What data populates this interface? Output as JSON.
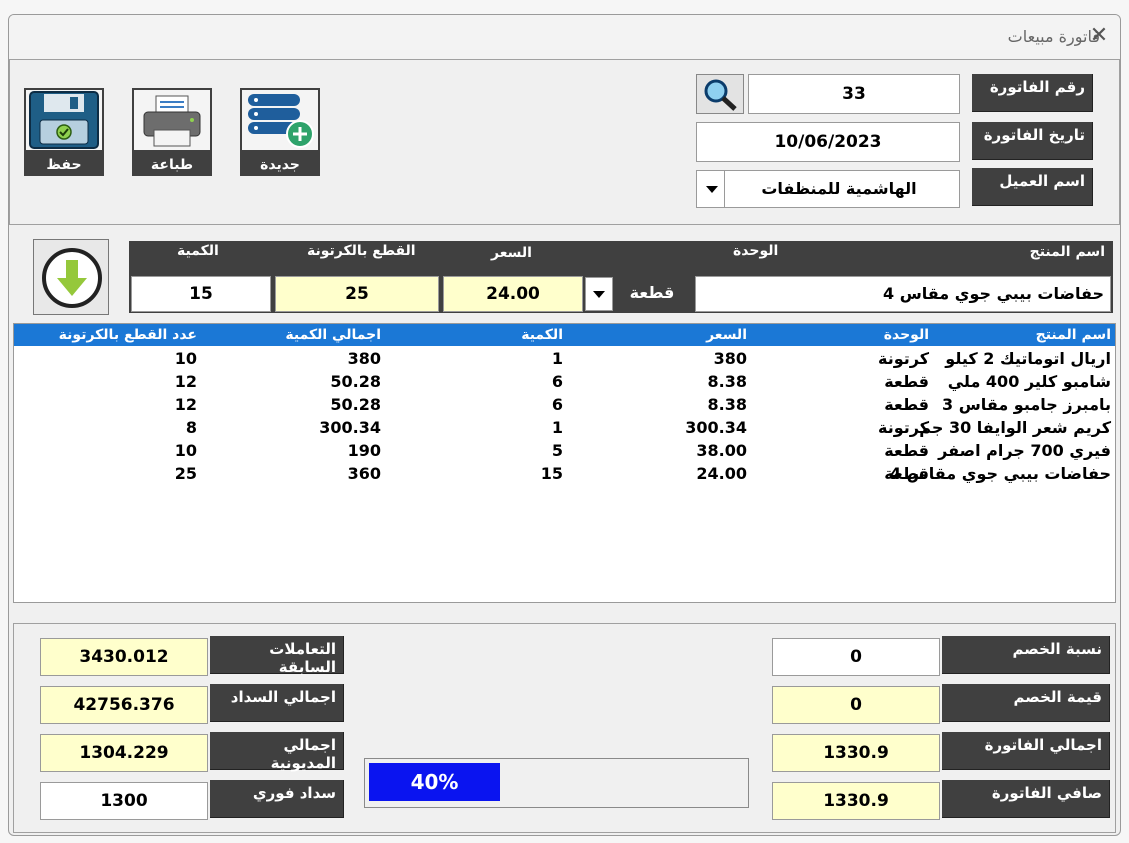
{
  "window": {
    "title": "فاتورة مبيعات",
    "close_glyph": "✕"
  },
  "toolbar": {
    "save_label": "حفظ",
    "print_label": "طباعة",
    "new_label": "جديدة"
  },
  "header": {
    "invoice_no_label": "رقم الفاتورة",
    "invoice_no": "33",
    "invoice_date_label": "تاريخ الفاتورة",
    "invoice_date": "10/06/2023",
    "customer_label": "اسم العميل",
    "customer": "الهاشمية للمنظفات"
  },
  "entry": {
    "labels": {
      "product": "اسم المنتج",
      "unit": "الوحدة",
      "price": "السعر",
      "per_carton": "القطع بالكرتونة",
      "qty": "الكمية"
    },
    "product": "حفاضات بيبي جوي مقاس 4",
    "unit": "قطعة",
    "price": "24.00",
    "per_carton": "25",
    "qty": "15"
  },
  "table": {
    "headers": {
      "product": "اسم المنتج",
      "unit": "الوحدة",
      "price": "السعر",
      "qty": "الكمية",
      "total": "اجمالي الكمية",
      "per_carton": "عدد القطع بالكرتونة"
    },
    "rows": [
      {
        "product": "اريال اتوماتيك 2 كيلو",
        "unit": "كرتونة",
        "price": "380",
        "qty": "1",
        "total": "380",
        "per_carton": "10"
      },
      {
        "product": "شامبو كلير 400 ملي",
        "unit": "قطعة",
        "price": "8.38",
        "qty": "6",
        "total": "50.28",
        "per_carton": "12"
      },
      {
        "product": "بامبرز جامبو مقاس 3",
        "unit": "قطعة",
        "price": "8.38",
        "qty": "6",
        "total": "50.28",
        "per_carton": "12"
      },
      {
        "product": "كريم شعر الوايفا 30 جم",
        "unit": "كرتونة",
        "price": "300.34",
        "qty": "1",
        "total": "300.34",
        "per_carton": "8"
      },
      {
        "product": "فيري 700 جرام اصفر",
        "unit": "قطعة",
        "price": "38.00",
        "qty": "5",
        "total": "190",
        "per_carton": "10"
      },
      {
        "product": "حفاضات بيبي جوي مقاس 4",
        "unit": "قطعة",
        "price": "24.00",
        "qty": "15",
        "total": "360",
        "per_carton": "25"
      }
    ]
  },
  "summary": {
    "discount_pct_label": "نسبة الخصم",
    "discount_pct": "0",
    "discount_value_label": "قيمة الخصم",
    "discount_value": "0",
    "invoice_total_label": "اجمالي الفاتورة",
    "invoice_total": "1330.9",
    "invoice_net_label": "صافي الفاتورة",
    "invoice_net": "1330.9",
    "prev_label": "التعاملات السابقة",
    "prev": "3430.012",
    "paid_total_label": "اجمالي السداد",
    "paid_total": "42756.376",
    "debt_total_label": "اجمالي المديونية",
    "debt_total": "1304.229",
    "instant_label": "سداد فوري",
    "instant": "1300"
  },
  "progress": {
    "text": "40%",
    "fraction": 0.4
  },
  "colors": {
    "dark_label": "#404040",
    "yellow_field": "#ffffcc",
    "list_header": "#1b78d6",
    "progress": "#0a14f0"
  },
  "icons": {
    "search": "search-icon",
    "dropdown": "chevron-down-icon",
    "add_row": "arrow-down-icon",
    "save": "floppy-disk-icon",
    "print": "printer-icon",
    "new": "add-database-icon"
  }
}
